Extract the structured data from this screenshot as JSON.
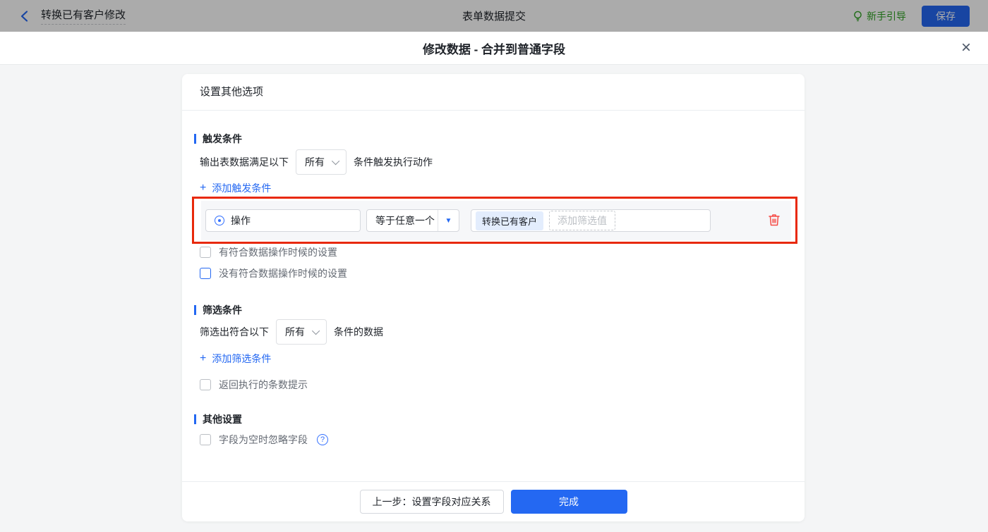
{
  "topbar": {
    "back_label": "转换已有客户修改",
    "title": "表单数据提交",
    "guide_label": "新手引导",
    "save_label": "保存"
  },
  "modal": {
    "title": "修改数据 - 合并到普通字段"
  },
  "panel": {
    "header": "设置其他选项",
    "trigger": {
      "heading": "触发条件",
      "prefix": "输出表数据满足以下",
      "select_value": "所有",
      "suffix": "条件触发执行动作",
      "add_link": "添加触发条件",
      "condition_row": {
        "field_value": "操作",
        "operator_value": "等于任意一个",
        "value_tag": "转换已有客户",
        "value_placeholder": "添加筛选值"
      },
      "checkbox_has": "有符合数据操作时候的设置",
      "checkbox_none": "没有符合数据操作时候的设置"
    },
    "filter": {
      "heading": "筛选条件",
      "prefix": "筛选出符合以下",
      "select_value": "所有",
      "suffix": "条件的数据",
      "add_link": "添加筛选条件",
      "checkbox_count": "返回执行的条数提示"
    },
    "other": {
      "heading": "其他设置",
      "checkbox_empty": "字段为空时忽略字段"
    },
    "footer": {
      "prev_label": "上一步：设置字段对应关系",
      "done_label": "完成"
    }
  },
  "icons": {
    "close": "×",
    "plus": "+",
    "caret_down": "▼",
    "question": "?"
  },
  "colors": {
    "accent_blue": "#2468f2",
    "link_blue": "#2468f2",
    "annotation_red": "#e8290b",
    "delete_red": "#f54a45",
    "guide_green": "#2ea121",
    "tag_blue_bg": "#e3edfd"
  }
}
